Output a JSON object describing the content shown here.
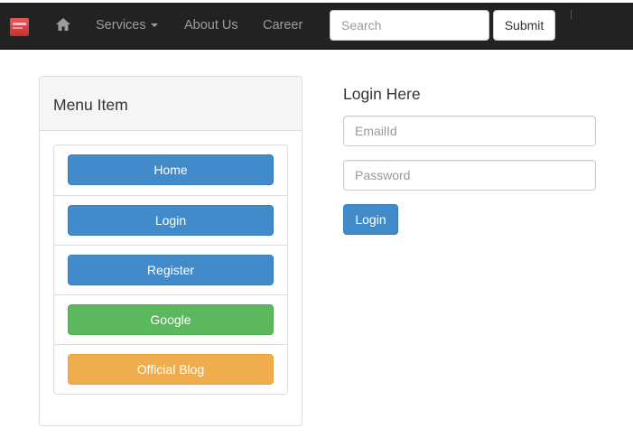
{
  "navbar": {
    "brand_icon": "brand-logo",
    "home_icon": "home-icon",
    "services_label": "Services",
    "about_label": "About Us",
    "career_label": "Career",
    "search_placeholder": "Search",
    "search_value": "",
    "submit_label": "Submit",
    "background": "#222222",
    "link_color": "#9d9d9d"
  },
  "menu_panel": {
    "title": "Menu Item",
    "items": [
      {
        "label": "Home",
        "style": "primary",
        "color": "#428bca"
      },
      {
        "label": "Login",
        "style": "primary",
        "color": "#428bca"
      },
      {
        "label": "Register",
        "style": "primary",
        "color": "#428bca"
      },
      {
        "label": "Google",
        "style": "success",
        "color": "#5cb85c"
      },
      {
        "label": "Official Blog",
        "style": "warning",
        "color": "#f0ad4e"
      }
    ]
  },
  "login_form": {
    "title": "Login Here",
    "email_placeholder": "EmailId",
    "email_value": "",
    "password_placeholder": "Password",
    "password_value": "",
    "submit_label": "Login",
    "button_color": "#428bca"
  }
}
